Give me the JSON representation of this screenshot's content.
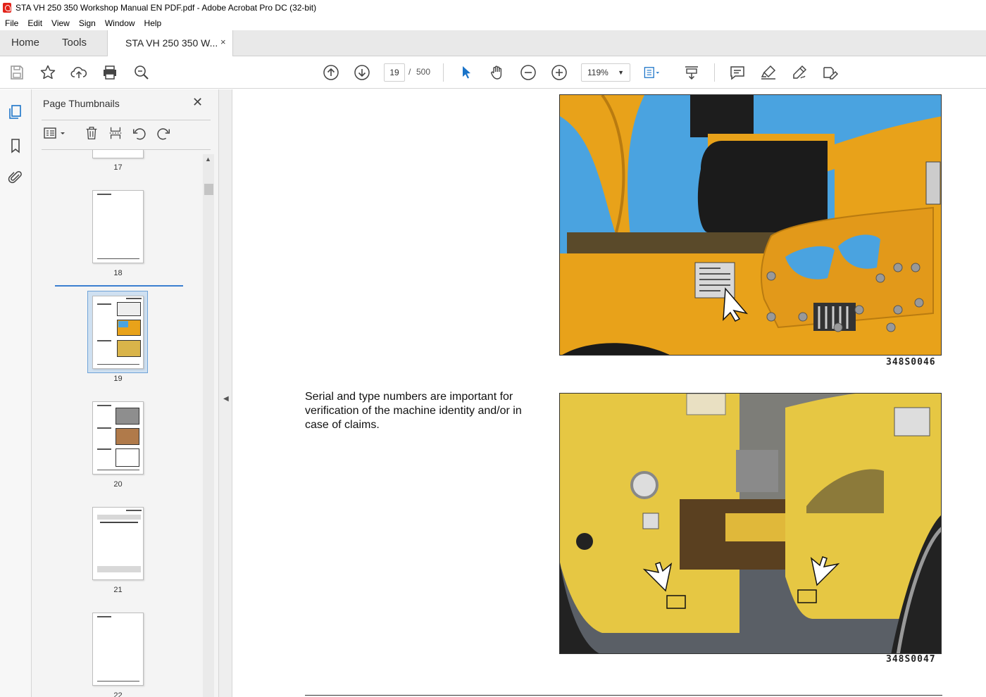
{
  "window": {
    "title": "STA VH 250 350 Workshop Manual EN PDF.pdf - Adobe Acrobat Pro DC (32-bit)"
  },
  "menu": [
    "File",
    "Edit",
    "View",
    "Sign",
    "Window",
    "Help"
  ],
  "tabs": {
    "home": "Home",
    "tools": "Tools",
    "document": "STA VH 250 350 W...",
    "close": "×"
  },
  "toolbar": {
    "current_page": "19",
    "page_separator": "/",
    "total_pages": "500",
    "zoom": "119%",
    "icons": [
      "save-icon",
      "bookmark-star-icon",
      "upload-cloud-icon",
      "print-icon",
      "search-zoom-icon",
      "page-up-icon",
      "page-down-icon",
      "select-cursor-icon",
      "hand-tool-icon",
      "zoom-out-icon",
      "zoom-in-icon",
      "fit-page-icon",
      "scroll-mode-icon",
      "comment-icon",
      "highlight-icon",
      "draw-icon",
      "fill-sign-icon"
    ]
  },
  "sidebar": {
    "title": "Page Thumbnails",
    "close": "✕",
    "thumbnails": [
      {
        "label": "17"
      },
      {
        "label": "18"
      },
      {
        "label": "19",
        "selected": true
      },
      {
        "label": "20"
      },
      {
        "label": "21"
      },
      {
        "label": "22"
      }
    ]
  },
  "document": {
    "figure_1_code": "348S0046",
    "figure_2_code": "348S0047",
    "body_text": "Serial and type numbers are important for verification of the machine identity and/or in case of claims."
  },
  "colors": {
    "machine_yellow": "#e8a21a",
    "sky_blue": "#4aa3e0",
    "accent_blue": "#1a73c8",
    "adobe_red": "#e2231a"
  }
}
